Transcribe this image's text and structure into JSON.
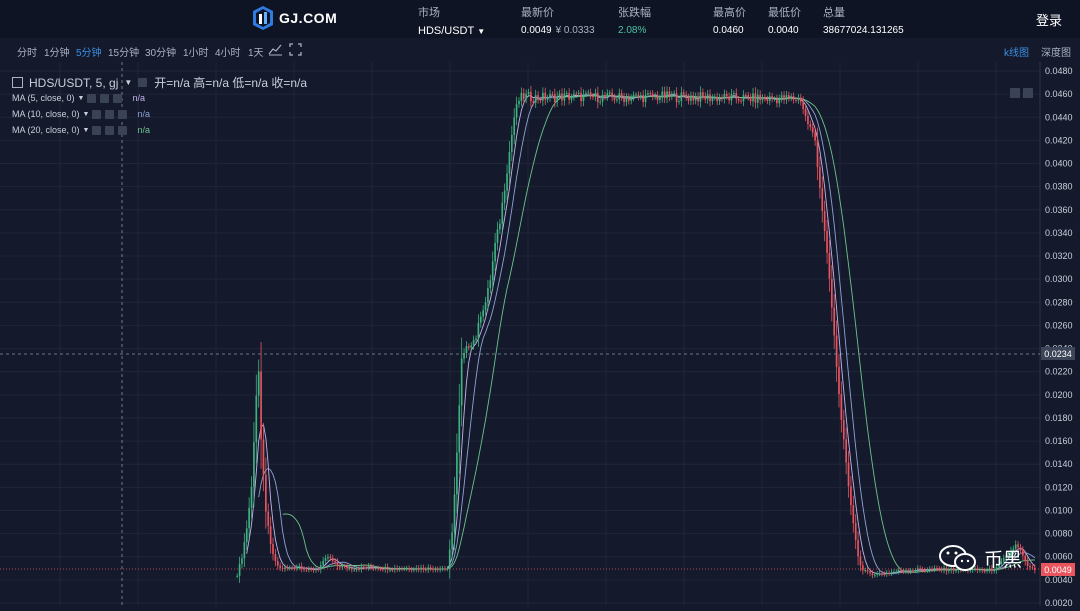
{
  "header": {
    "logo_text": "GJ.COM",
    "market_label": "市场",
    "market_value": "HDS/USDT",
    "latest_label": "最新价",
    "latest_value": "0.0049",
    "latest_cny": "¥ 0.0333",
    "change_label": "张跌幅",
    "change_value": "2.08%",
    "high_label": "最高价",
    "high_value": "0.0460",
    "low_label": "最低价",
    "low_value": "0.0040",
    "volume_label": "总量",
    "volume_value": "38677024.131265",
    "login_label": "登录"
  },
  "toolbar": {
    "intervals": [
      "分时",
      "1分钟",
      "5分钟",
      "15分钟",
      "30分钟",
      "1小时",
      "4小时",
      "1天"
    ],
    "active_interval": "5分钟",
    "kline_label": "k线图",
    "depth_label": "深度图"
  },
  "legend": {
    "symbol": "HDS/USDT, 5, gj",
    "ohlc": "开=n/a  高=n/a  低=n/a  收=n/a",
    "ma5_label": "MA (5, close, 0)",
    "ma5_value": "n/a",
    "ma10_label": "MA (10, close, 0)",
    "ma10_value": "n/a",
    "ma20_label": "MA (20, close, 0)",
    "ma20_value": "n/a"
  },
  "colors": {
    "up": "#3fb27f",
    "down": "#e8555f",
    "ma5": "#c5b3ee",
    "ma10": "#8fa2d6",
    "ma20": "#6cc48a",
    "accent": "#3a8fe6"
  },
  "crosshair_price": "0.0234",
  "last_price_tag": "0.0049",
  "watermark_text": "币黑",
  "chart_data": {
    "type": "candlestick",
    "y_ticks": [
      "0.0480",
      "0.0460",
      "0.0440",
      "0.0420",
      "0.0400",
      "0.0380",
      "0.0360",
      "0.0340",
      "0.0320",
      "0.0300",
      "0.0280",
      "0.0260",
      "0.0240",
      "0.0220",
      "0.0200",
      "0.0180",
      "0.0160",
      "0.0140",
      "0.0120",
      "0.0100",
      "0.0080",
      "0.0060",
      "0.0040",
      "0.0020"
    ],
    "ylim": [
      0.002,
      0.048
    ],
    "close_path": [
      [
        0,
        0.0045
      ],
      [
        2,
        0.006
      ],
      [
        4,
        0.0085
      ],
      [
        6,
        0.012
      ],
      [
        8,
        0.02
      ],
      [
        9,
        0.022
      ],
      [
        10,
        0.016
      ],
      [
        12,
        0.01
      ],
      [
        14,
        0.007
      ],
      [
        16,
        0.0055
      ],
      [
        18,
        0.005
      ],
      [
        22,
        0.005
      ],
      [
        26,
        0.0052
      ],
      [
        30,
        0.0048
      ],
      [
        34,
        0.005
      ],
      [
        38,
        0.006
      ],
      [
        42,
        0.0052
      ],
      [
        48,
        0.005
      ],
      [
        56,
        0.0051
      ],
      [
        64,
        0.005
      ],
      [
        74,
        0.005
      ],
      [
        82,
        0.005
      ],
      [
        88,
        0.005
      ],
      [
        90,
        0.008
      ],
      [
        92,
        0.015
      ],
      [
        94,
        0.023
      ],
      [
        96,
        0.024
      ],
      [
        98,
        0.0245
      ],
      [
        100,
        0.025
      ],
      [
        102,
        0.027
      ],
      [
        104,
        0.028
      ],
      [
        106,
        0.03
      ],
      [
        108,
        0.033
      ],
      [
        110,
        0.035
      ],
      [
        112,
        0.038
      ],
      [
        114,
        0.041
      ],
      [
        116,
        0.044
      ],
      [
        118,
        0.0455
      ],
      [
        120,
        0.0458
      ],
      [
        125,
        0.0457
      ],
      [
        140,
        0.0458
      ],
      [
        160,
        0.0457
      ],
      [
        180,
        0.0458
      ],
      [
        200,
        0.0457
      ],
      [
        220,
        0.0456
      ],
      [
        236,
        0.0456
      ],
      [
        238,
        0.044
      ],
      [
        240,
        0.043
      ],
      [
        242,
        0.042
      ],
      [
        244,
        0.038
      ],
      [
        246,
        0.034
      ],
      [
        248,
        0.03
      ],
      [
        250,
        0.025
      ],
      [
        252,
        0.02
      ],
      [
        254,
        0.016
      ],
      [
        256,
        0.012
      ],
      [
        258,
        0.009
      ],
      [
        260,
        0.006
      ],
      [
        262,
        0.0048
      ],
      [
        264,
        0.0046
      ],
      [
        268,
        0.0045
      ],
      [
        272,
        0.0046
      ],
      [
        278,
        0.0048
      ],
      [
        286,
        0.0049
      ],
      [
        296,
        0.0049
      ],
      [
        306,
        0.0049
      ],
      [
        314,
        0.0048
      ],
      [
        318,
        0.005
      ],
      [
        322,
        0.006
      ],
      [
        326,
        0.007
      ],
      [
        328,
        0.0065
      ],
      [
        330,
        0.0055
      ],
      [
        332,
        0.005
      ],
      [
        334,
        0.0049
      ]
    ],
    "ma_series": [
      {
        "name": "MA (5, close, 0)"
      },
      {
        "name": "MA (10, close, 0)"
      },
      {
        "name": "MA (20, close, 0)"
      }
    ]
  }
}
